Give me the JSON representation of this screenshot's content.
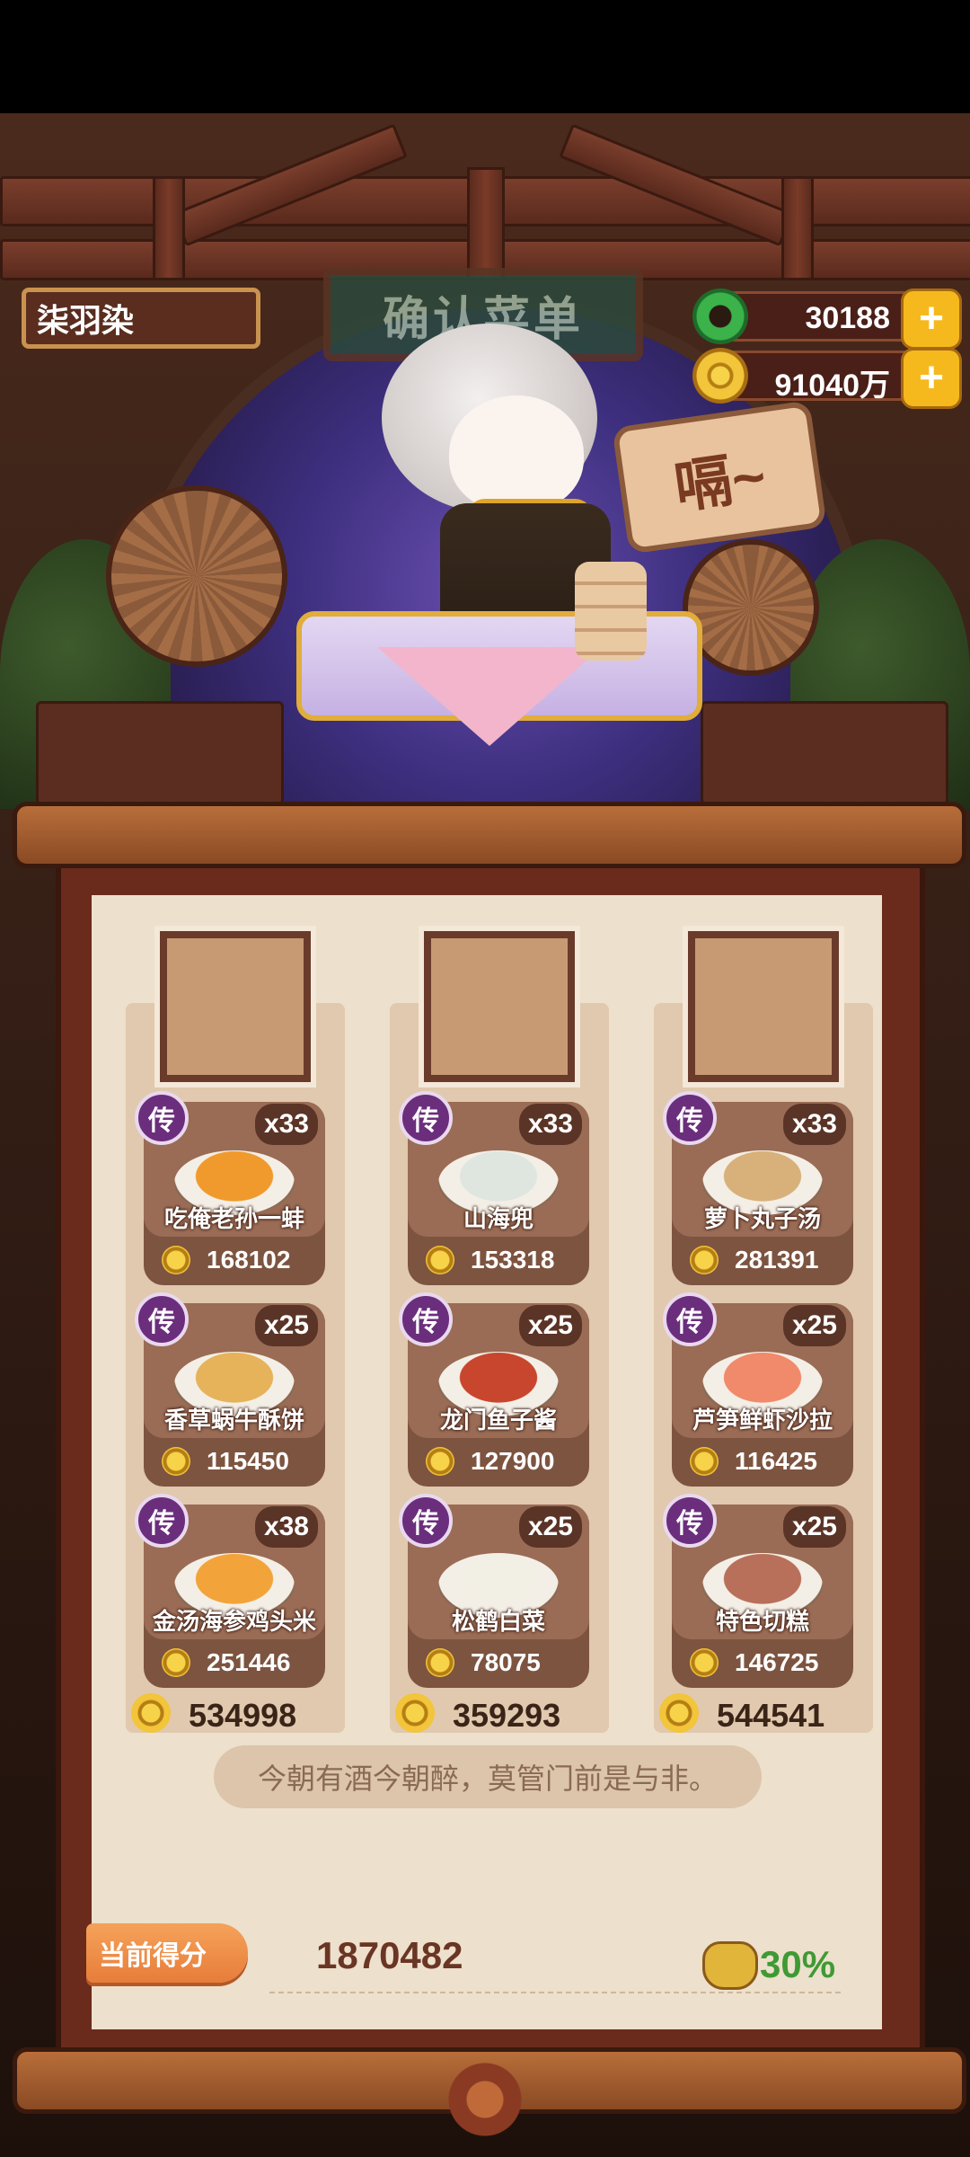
{
  "header": {
    "sign_text": "确认菜单",
    "player_name": "柒羽染",
    "jade_amount": "30188",
    "coin_amount": "91040万",
    "plus_label": "+"
  },
  "speech": {
    "text": "嗝~"
  },
  "columns": [
    {
      "dishes": [
        {
          "badge": "传",
          "name": "吃俺老孙一蚌",
          "qty": "x33",
          "price": "168102",
          "color": "#f09a2e"
        },
        {
          "badge": "传",
          "name": "香草蜗牛酥饼",
          "qty": "x25",
          "price": "115450",
          "color": "#e6b25a"
        },
        {
          "badge": "传",
          "name": "金汤海参鸡头米",
          "qty": "x38",
          "price": "251446",
          "color": "#f2a43a"
        }
      ],
      "total": "534998"
    },
    {
      "dishes": [
        {
          "badge": "传",
          "name": "山海兜",
          "qty": "x33",
          "price": "153318",
          "color": "#dfe6e0"
        },
        {
          "badge": "传",
          "name": "龙门鱼子酱",
          "qty": "x25",
          "price": "127900",
          "color": "#c8462e"
        },
        {
          "badge": "传",
          "name": "松鹤白菜",
          "qty": "x25",
          "price": "78075",
          "color": "#f2efe5"
        }
      ],
      "total": "359293"
    },
    {
      "dishes": [
        {
          "badge": "传",
          "name": "萝卜丸子汤",
          "qty": "x33",
          "price": "281391",
          "color": "#d8b07a"
        },
        {
          "badge": "传",
          "name": "芦笋鲜虾沙拉",
          "qty": "x25",
          "price": "116425",
          "color": "#f08a6a"
        },
        {
          "badge": "传",
          "name": "特色切糕",
          "qty": "x25",
          "price": "146725",
          "color": "#b8705a"
        }
      ],
      "total": "544541"
    }
  ],
  "quote": "今朝有酒今朝醉，莫管门前是与非。",
  "score": {
    "label": "当前得分",
    "value": "1870482",
    "bonus": "30%"
  },
  "colors": {
    "badge": "#6b2e7c",
    "plus": "#f6b91d",
    "bonus": "#3f9a34",
    "coin": "#f2c53a"
  }
}
